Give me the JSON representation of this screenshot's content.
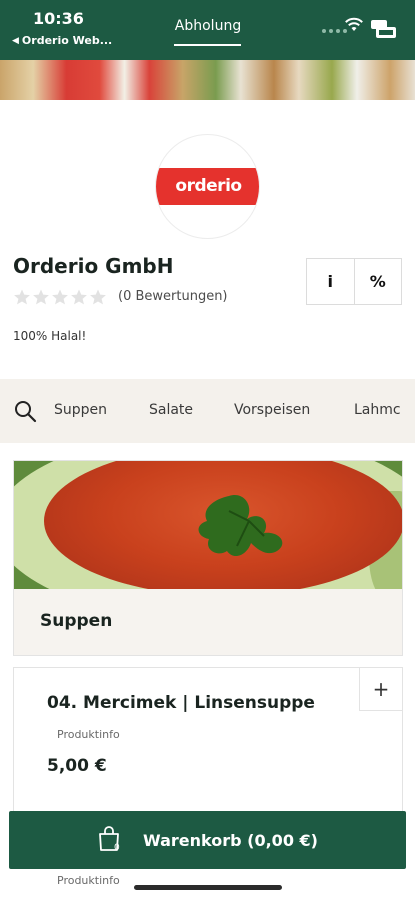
{
  "status_bar": {
    "time": "10:36",
    "back_label": "Orderio Web...",
    "tab_label": "Abholung"
  },
  "colors": {
    "primary": "#1d5a43",
    "brand_red": "#e5322d",
    "nav_bg": "#f4f1ec"
  },
  "restaurant": {
    "logo_text": "orderio",
    "name": "Orderio GmbH",
    "rating_stars": 0,
    "ratings_label": "(0 Bewertungen)",
    "tagline": "100% Halal!",
    "info_button": "i",
    "discount_button": "%"
  },
  "category_nav": {
    "search_icon": "search-icon",
    "items": [
      "Suppen",
      "Salate",
      "Vorspeisen",
      "Lahmc"
    ]
  },
  "category_section": {
    "title": "Suppen"
  },
  "product": {
    "name": "04. Mercimek | Linsensuppe",
    "info_label": "Produktinfo",
    "price": "5,00 €",
    "add_icon": "+"
  },
  "next_product": {
    "info_label": "Produktinfo"
  },
  "cart": {
    "label": "Warenkorb (0,00 €)",
    "count": "0"
  }
}
